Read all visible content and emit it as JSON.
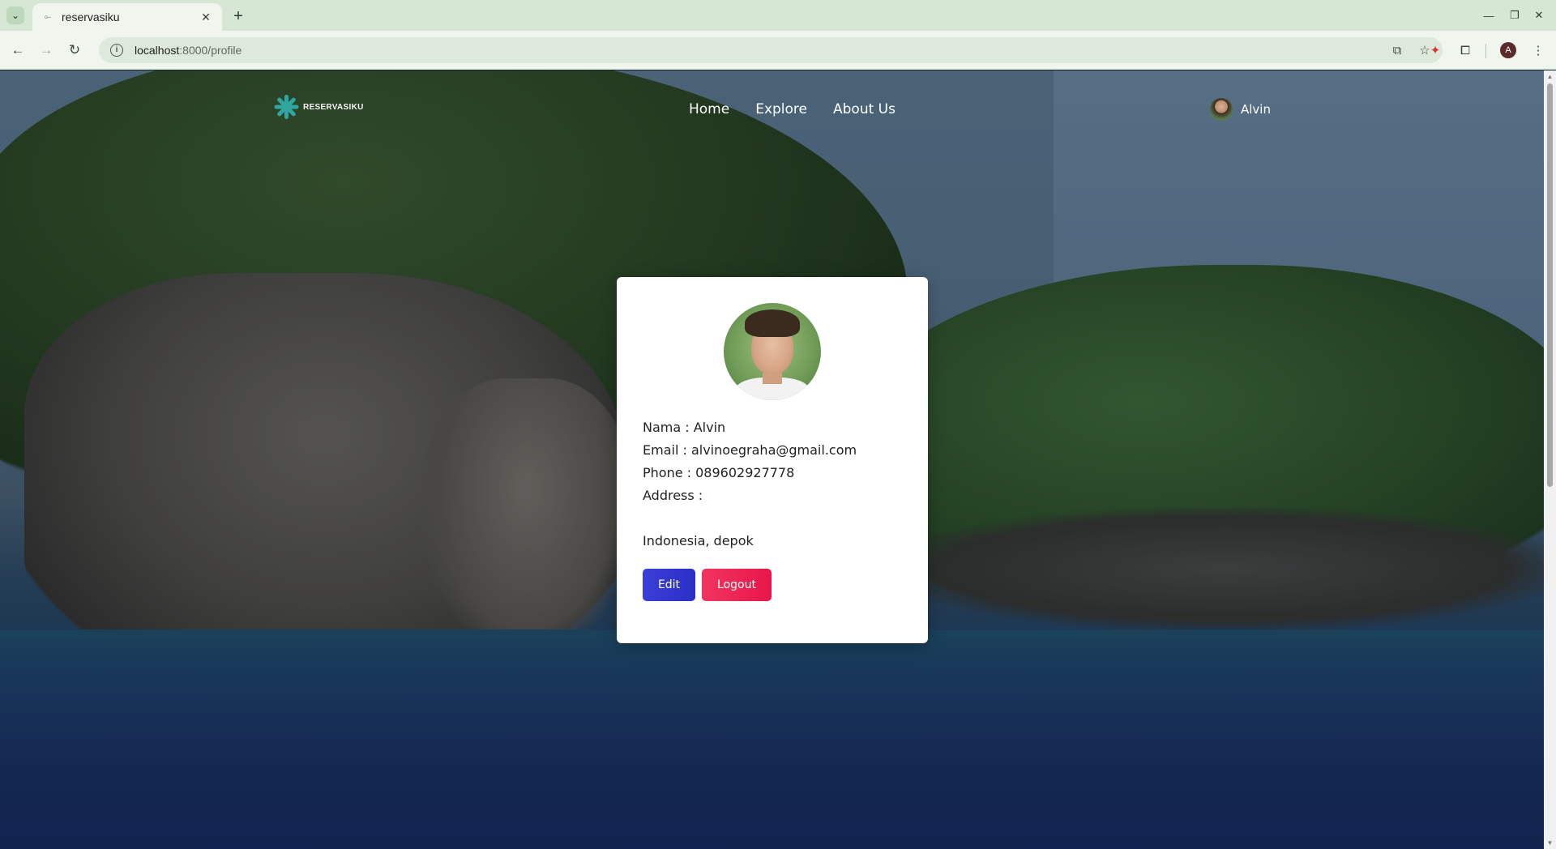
{
  "browser": {
    "tab_title": "reservasiku",
    "new_tab_symbol": "+",
    "url_host": "localhost",
    "url_path": ":8000/profile",
    "profile_initial": "A"
  },
  "site": {
    "logo_text": "RESERVASIKU",
    "nav": [
      "Home",
      "Explore",
      "About Us"
    ],
    "user_name": "Alvin"
  },
  "profile": {
    "name_line": "Nama : Alvin",
    "email_line": "Email : alvinoegraha@gmail.com",
    "phone_line": "Phone : 089602927778",
    "address_label": "Address :",
    "address_value": "Indonesia, depok",
    "edit_label": "Edit",
    "logout_label": "Logout"
  },
  "colors": {
    "edit_button": "#3b3fd8",
    "logout_button": "#ec2553",
    "logo_accent": "#2fa7a0"
  }
}
